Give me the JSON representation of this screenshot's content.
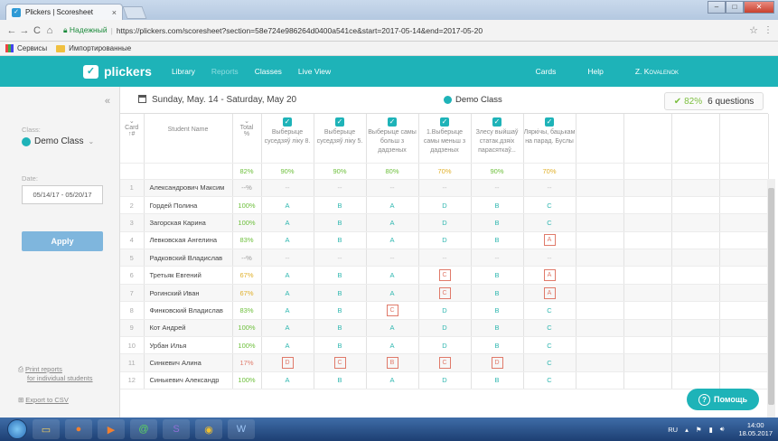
{
  "browser": {
    "tab_title": "Plickers | Scoresheet",
    "tab_close": "×",
    "secure_label": "Надежный",
    "url": "https://plickers.com/scoresheet?section=58e724e986264d0400a541ce&start=2017-05-14&end=2017-05-20",
    "bookmarks": [
      "Сервисы",
      "Импортированные"
    ]
  },
  "appnav": {
    "logo": "plickers",
    "links": [
      "Library",
      "Reports",
      "Classes",
      "Live View"
    ],
    "right_links": [
      "Cards",
      "Help",
      "Z. Kovalenok"
    ]
  },
  "sidebar": {
    "class_label": "Class:",
    "class_value": "Demo Class",
    "date_label": "Date:",
    "date_value": "05/14/17 - 05/20/17",
    "apply_label": "Apply",
    "print_line1": "Print reports",
    "print_line2": "for individual students",
    "export_label": "Export to CSV"
  },
  "scoresheet": {
    "date_range": "Sunday, May. 14 - Saturday, May 20",
    "class_name": "Demo Class",
    "summary_pct": "82%",
    "summary_questions": "6 questions",
    "col_card": "Card",
    "col_card_sort": "↑#",
    "col_name": "Student Name",
    "col_total": "Total",
    "col_total_unit": "%",
    "questions": [
      "Выберыце суседзяў ліку 8.",
      "Выберыце суседзяў ліку 5.",
      "Выберыце самы больш з дадзеных",
      "1.Выберыце самы меньш з дадзеных",
      "Злесу выйшаў статак.дзяіх парасяткаў...",
      "Ляркічы, бацькам на парад. Буслы"
    ],
    "question_pcts": [
      "90%",
      "90%",
      "80%",
      "70%",
      "90%",
      "70%"
    ],
    "total_pct": "82%",
    "students": [
      {
        "num": "1",
        "name": "Александрович Максим",
        "total": "--%",
        "answers": [
          "--",
          "--",
          "--",
          "--",
          "--",
          "--"
        ]
      },
      {
        "num": "2",
        "name": "Гордей Полина",
        "total": "100%",
        "answers": [
          "A",
          "B",
          "A",
          "D",
          "B",
          "C"
        ]
      },
      {
        "num": "3",
        "name": "Загорская Карина",
        "total": "100%",
        "answers": [
          "A",
          "B",
          "A",
          "D",
          "B",
          "C"
        ]
      },
      {
        "num": "4",
        "name": "Левковская Ангелина",
        "total": "83%",
        "answers": [
          "A",
          "B",
          "A",
          "D",
          "B",
          "A"
        ]
      },
      {
        "num": "5",
        "name": "Радковский Владислав",
        "total": "--%",
        "answers": [
          "--",
          "--",
          "--",
          "--",
          "--",
          "--"
        ]
      },
      {
        "num": "6",
        "name": "Третьяк Евгений",
        "total": "67%",
        "answers": [
          "A",
          "B",
          "A",
          "C",
          "B",
          "A"
        ]
      },
      {
        "num": "7",
        "name": "Рогинский Иван",
        "total": "67%",
        "answers": [
          "A",
          "B",
          "A",
          "C",
          "B",
          "A"
        ]
      },
      {
        "num": "8",
        "name": "Финковский Владислав",
        "total": "83%",
        "answers": [
          "A",
          "B",
          "C",
          "D",
          "B",
          "C"
        ]
      },
      {
        "num": "9",
        "name": "Кот Андрей",
        "total": "100%",
        "answers": [
          "A",
          "B",
          "A",
          "D",
          "B",
          "C"
        ]
      },
      {
        "num": "10",
        "name": "Урбан Илья",
        "total": "100%",
        "answers": [
          "A",
          "B",
          "A",
          "D",
          "B",
          "C"
        ]
      },
      {
        "num": "11",
        "name": "Синкевич Алина",
        "total": "17%",
        "answers": [
          "D",
          "C",
          "B",
          "C",
          "D",
          "C"
        ]
      },
      {
        "num": "12",
        "name": "Синькевич Александр",
        "total": "100%",
        "answers": [
          "A",
          "B",
          "A",
          "D",
          "B",
          "C"
        ]
      }
    ],
    "wrong": [
      [
        false,
        false,
        false,
        false,
        false,
        false
      ],
      [
        false,
        false,
        false,
        false,
        false,
        false
      ],
      [
        false,
        false,
        false,
        false,
        false,
        false
      ],
      [
        false,
        false,
        false,
        false,
        false,
        true
      ],
      [
        false,
        false,
        false,
        false,
        false,
        false
      ],
      [
        false,
        false,
        false,
        true,
        false,
        true
      ],
      [
        false,
        false,
        false,
        true,
        false,
        true
      ],
      [
        false,
        false,
        true,
        false,
        false,
        false
      ],
      [
        false,
        false,
        false,
        false,
        false,
        false
      ],
      [
        false,
        false,
        false,
        false,
        false,
        false
      ],
      [
        true,
        true,
        true,
        true,
        true,
        false
      ],
      [
        false,
        false,
        false,
        false,
        false,
        false
      ]
    ],
    "empty_cols": 4
  },
  "help_button": "Помощь",
  "taskbar": {
    "lang": "RU",
    "time": "14:00",
    "date": "18.05.2017"
  },
  "colors": {
    "accent": "#1eb3b8",
    "good": "#6cbf3a",
    "warn": "#e0b02a",
    "bad": "#e07a6a"
  }
}
